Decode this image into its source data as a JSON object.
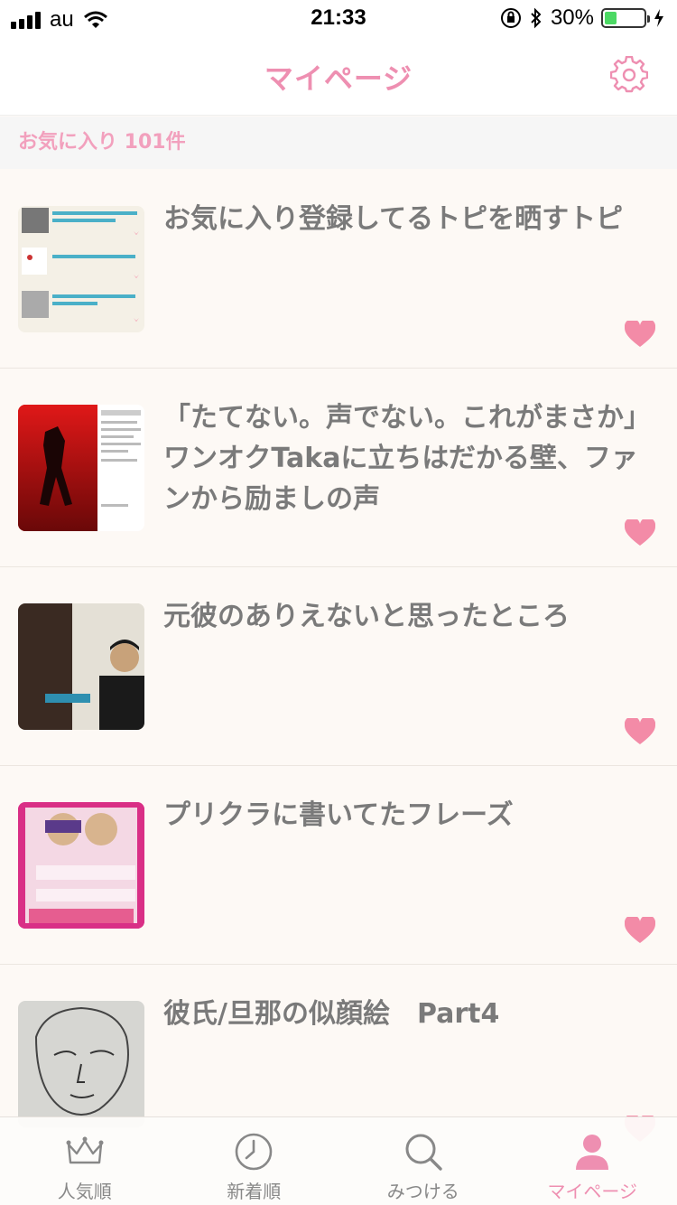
{
  "status_bar": {
    "carrier": "au",
    "time": "21:33",
    "battery": "30%",
    "battery_level": 0.3
  },
  "header": {
    "title": "マイページ"
  },
  "favorites": {
    "label": "お気に入り 101件"
  },
  "items": [
    {
      "title": "お気に入り登録してるトピを晒すトピ"
    },
    {
      "title": "「たてない。声でない。これがまさか」ワンオクTakaに立ちはだかる壁、ファンから励ましの声"
    },
    {
      "title": "元彼のありえないと思ったところ"
    },
    {
      "title": "プリクラに書いてたフレーズ"
    },
    {
      "title": "彼氏/旦那の似顔絵　Part4"
    }
  ],
  "tabs": [
    {
      "label": "人気順",
      "icon": "crown-icon"
    },
    {
      "label": "新着順",
      "icon": "clock-icon"
    },
    {
      "label": "みつける",
      "icon": "search-icon"
    },
    {
      "label": "マイページ",
      "icon": "person-icon"
    }
  ],
  "colors": {
    "accent": "#ee8fb1",
    "heart": "#f38ba7",
    "background": "#fdf9f5"
  }
}
